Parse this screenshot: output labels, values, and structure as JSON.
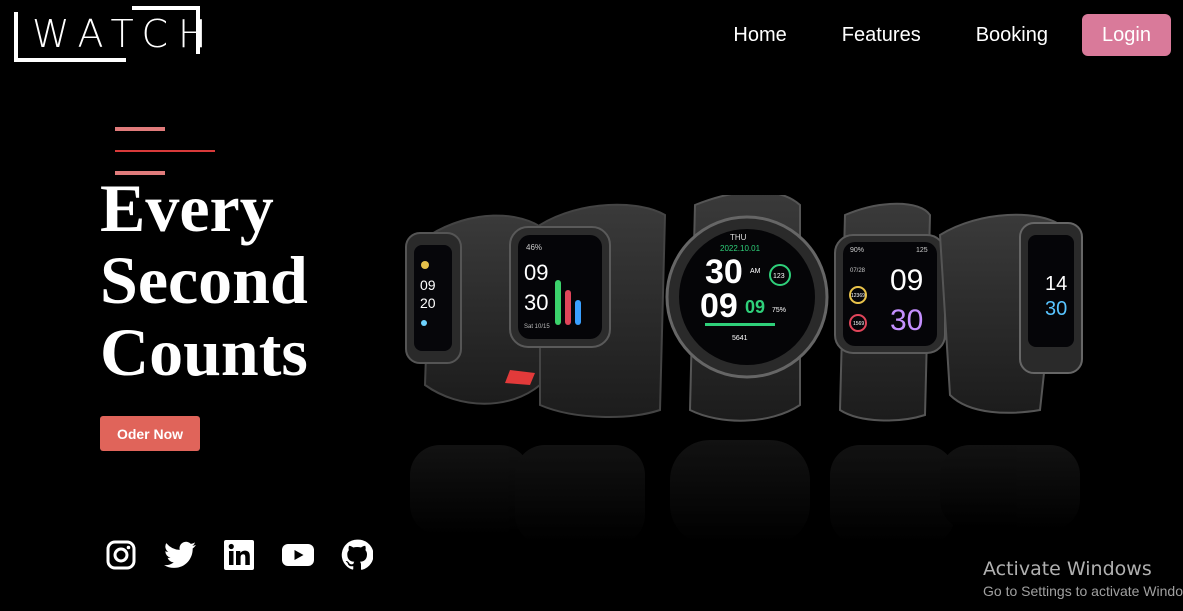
{
  "logo": {
    "text": "WATCH"
  },
  "nav": {
    "links": [
      "Home",
      "Features",
      "Booking"
    ],
    "login_label": "Login"
  },
  "hero": {
    "title_lines": [
      "Every",
      "Second",
      "Counts"
    ],
    "order_label": "Oder Now"
  },
  "watch_faces": {
    "band": {
      "l1": "09",
      "l2": "20"
    },
    "square1": {
      "top": "46%",
      "h": "09",
      "m": "30",
      "date": "Sat 10/15"
    },
    "round": {
      "day": "THU",
      "date": "2022.10.01",
      "h": "30",
      "m": "09",
      "s": "09",
      "am": "AM",
      "hr": "123",
      "pct": "75%",
      "steps": "5641"
    },
    "square2": {
      "top": "90%",
      "hr": "125",
      "h": "09",
      "m": "30",
      "date": "07/28",
      "steps": "12369",
      "cal": "1569"
    },
    "band2": {
      "l1": "14",
      "l2": "30"
    }
  },
  "social": {
    "icons": [
      "instagram-icon",
      "twitter-icon",
      "linkedin-icon",
      "youtube-icon",
      "github-icon"
    ]
  },
  "activation": {
    "title": "Activate Windows",
    "subtitle": "Go to Settings to activate Windows."
  },
  "colors": {
    "accent": "#d97a9a",
    "order_button": "#e0645a",
    "deco_line": "#e07b7b",
    "background": "#000000"
  }
}
